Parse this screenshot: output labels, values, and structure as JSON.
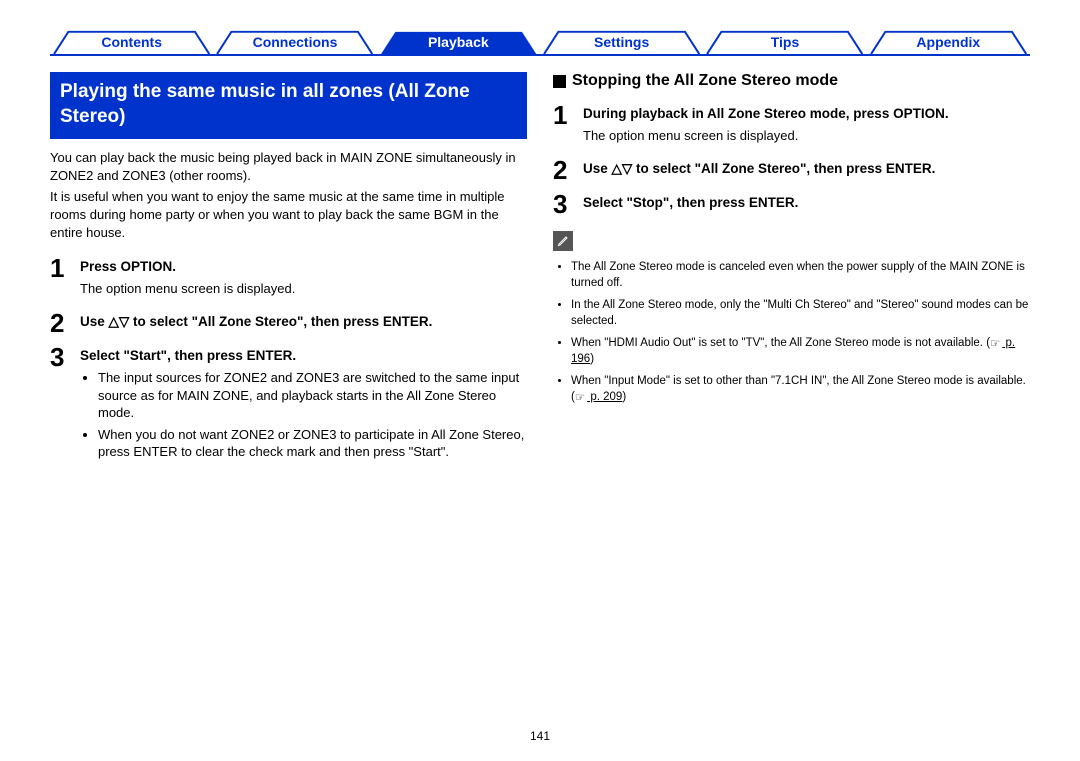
{
  "nav": {
    "tabs": [
      "Contents",
      "Connections",
      "Playback",
      "Settings",
      "Tips",
      "Appendix"
    ],
    "activeIndex": 2
  },
  "left": {
    "heading": "Playing the same music in all zones (All Zone Stereo)",
    "para1": "You can play back the music being played back in MAIN ZONE simultaneously in ZONE2 and ZONE3 (other rooms).",
    "para2": "It is useful when you want to enjoy the same music at the same time in multiple rooms during home party or when you want to play back the same BGM in the entire house.",
    "steps": [
      {
        "num": "1",
        "title": "Press OPTION.",
        "desc": "The option menu screen is displayed."
      },
      {
        "num": "2",
        "title_pre": "Use ",
        "title_post": " to select \"All Zone Stereo\", then press ENTER."
      },
      {
        "num": "3",
        "title": "Select \"Start\", then press ENTER.",
        "bullets": [
          "The input sources for ZONE2 and ZONE3 are switched to the same input source as for MAIN ZONE, and playback starts in the All Zone Stereo mode.",
          "When you do not want ZONE2 or ZONE3 to participate in All Zone Stereo, press ENTER to clear the check mark and then press \"Start\"."
        ]
      }
    ]
  },
  "right": {
    "subheading": "Stopping the All Zone Stereo mode",
    "steps": [
      {
        "num": "1",
        "title": "During playback in All Zone Stereo mode, press OPTION.",
        "desc": "The option menu screen is displayed."
      },
      {
        "num": "2",
        "title_pre": "Use ",
        "title_post": " to select \"All Zone Stereo\", then press ENTER."
      },
      {
        "num": "3",
        "title": "Select \"Stop\", then press ENTER."
      }
    ],
    "notes": [
      "The All Zone Stereo mode is canceled even when the power supply of the MAIN ZONE is turned off.",
      "In the All Zone Stereo mode, only the \"Multi Ch Stereo\" and \"Stereo\" sound modes can be selected."
    ],
    "note3_pre": "When \"HDMI Audio Out\" is set to \"TV\", the All Zone Stereo mode is not available. (",
    "note3_link": " p. 196",
    "note3_post": ")",
    "note4_pre": "When \"Input Mode\" is set to other than \"7.1CH IN\", the All Zone Stereo mode is available. (",
    "note4_link": " p. 209",
    "note4_post": ")"
  },
  "pageNumber": "141"
}
